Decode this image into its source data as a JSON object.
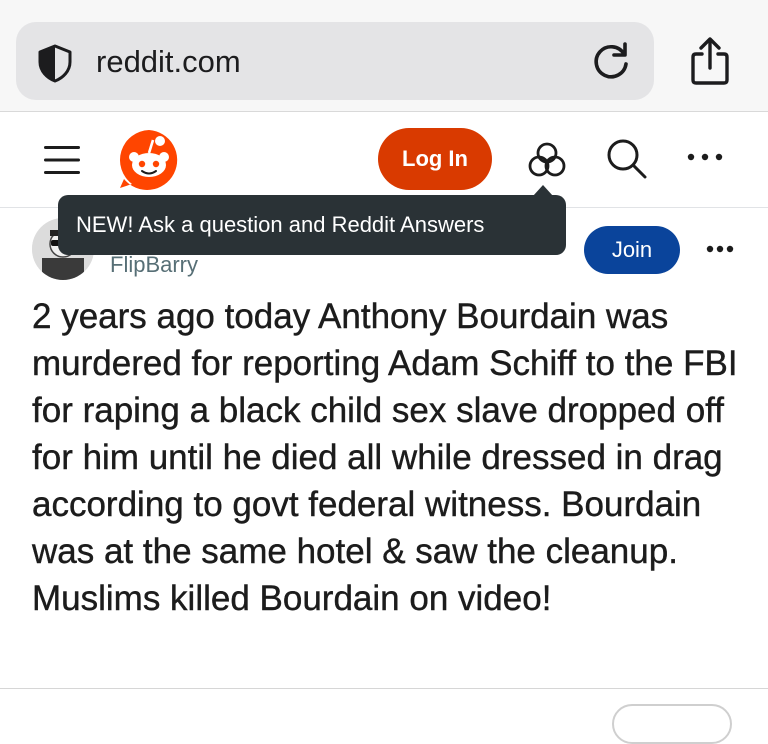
{
  "browser": {
    "url": "reddit.com",
    "icons": [
      "shield-icon",
      "reload-icon",
      "share-icon"
    ]
  },
  "header": {
    "login_label": "Log In",
    "brand_color": "#d93a00",
    "icons": [
      "menu-icon",
      "reddit-logo",
      "answers-icon",
      "search-icon",
      "more-icon"
    ]
  },
  "tooltip": {
    "text": "NEW! Ask a question and Reddit Answers"
  },
  "post": {
    "author": "FlipBarry",
    "join_label": "Join",
    "join_color": "#0a449b",
    "title": "2 years ago today Anthony Bourdain was murdered for reporting Adam Schiff to the FBI for raping a black child sex slave dropped off for him until he died all while dressed in drag according to govt federal witness. Bourdain was at the same hotel & saw the cleanup. Muslims killed Bourdain on video!"
  }
}
